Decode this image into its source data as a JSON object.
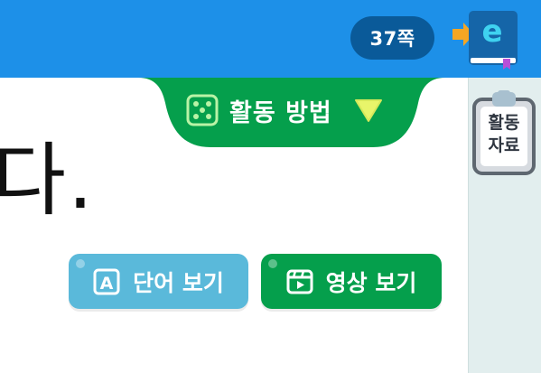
{
  "header": {
    "page_indicator": "37쪽",
    "ebook_icon": "ebook-e-icon",
    "colors": {
      "bar": "#1d90e8",
      "pill": "#0a5a99"
    }
  },
  "activity_tab": {
    "label": "활동 방법",
    "icon": "dice-icon",
    "toggle_icon": "triangle-down-icon",
    "color": "#059f4c"
  },
  "main": {
    "partial_text": "다."
  },
  "buttons": {
    "word": {
      "label": "단어 보기",
      "icon": "letter-a-icon",
      "color": "#5ab9da"
    },
    "video": {
      "label": "영상 보기",
      "icon": "video-icon",
      "color": "#059f4c"
    }
  },
  "side_panel": {
    "resource_label_line1": "활동",
    "resource_label_line2": "자료",
    "icon": "clipboard-icon"
  }
}
